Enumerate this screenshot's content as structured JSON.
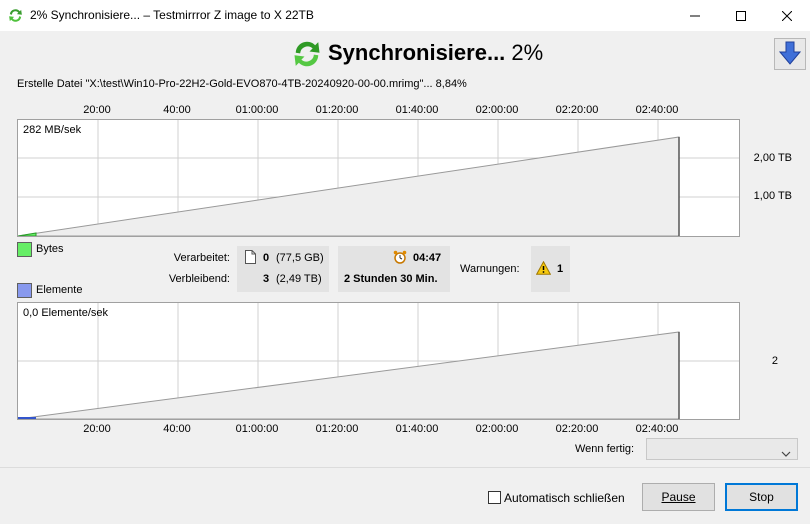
{
  "window": {
    "title": "2% Synchronisiere... – Testmirrror Z image to X 22TB"
  },
  "header": {
    "heading": "Synchronisiere...",
    "percent": "2%"
  },
  "status_line": "Erstelle Datei \"X:\\test\\Win10-Pro-22H2-Gold-EVO870-4TB-20240920-00-00.mrimg\"... 8,84%",
  "axis_ticks": [
    "20:00",
    "40:00",
    "01:00:00",
    "01:20:00",
    "01:40:00",
    "02:00:00",
    "02:20:00",
    "02:40:00"
  ],
  "bytes_chart": {
    "rate_label": "282 MB/sek",
    "y_labels": [
      "2,00 TB",
      "1,00 TB"
    ]
  },
  "elements_chart": {
    "rate_label": "0,0 Elemente/sek",
    "y_labels": [
      "2"
    ]
  },
  "legend": {
    "bytes": "Bytes",
    "elements": "Elemente",
    "bytes_color": "#66ee66",
    "elements_color": "#8899ee"
  },
  "stats": {
    "processed_label": "Verarbeitet:",
    "processed_count": "0",
    "processed_size": "(77,5 GB)",
    "remaining_label": "Verbleibend:",
    "remaining_count": "3",
    "remaining_size": "(2,49 TB)",
    "elapsed_time": "04:47",
    "remaining_time": "2 Stunden 30 Min.",
    "warnings_label": "Warnungen:",
    "warnings_count": "1"
  },
  "footer": {
    "when_done_label": "Wenn fertig:",
    "when_done_value": "",
    "auto_close_label": "Automatisch schließen",
    "pause_label": "Pause",
    "stop_label": "Stop"
  },
  "icons": {
    "sync": "sync-icon",
    "download": "arrow-down-icon",
    "file": "file-icon",
    "clock": "alarm-clock-icon",
    "warning": "warning-icon"
  }
}
